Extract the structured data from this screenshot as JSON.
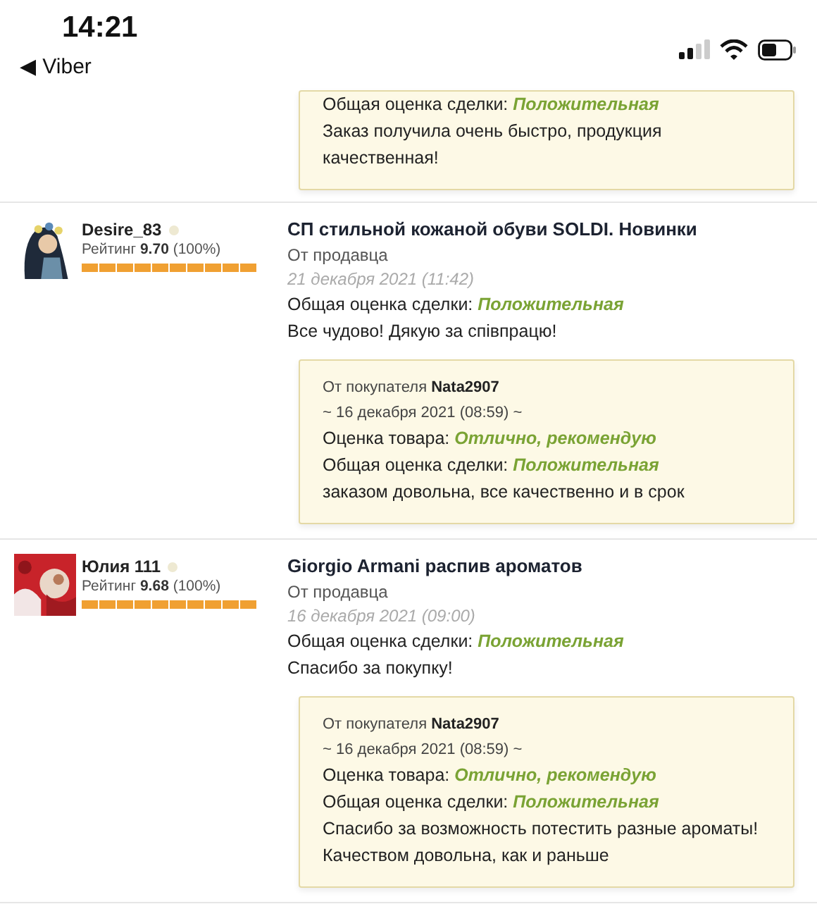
{
  "status_bar": {
    "time": "14:21",
    "back_label": "◀ Viber"
  },
  "partial_review": {
    "buyer_box": {
      "lines": [
        {
          "label": "Общая оценка сделки:",
          "value": "Положительная"
        }
      ],
      "comment": "Заказ получила очень быстро, продукция качественная!"
    }
  },
  "reviews": [
    {
      "user": {
        "name": "Desire_83",
        "online": false,
        "rating_label": "Рейтинг",
        "rating": "9.70",
        "percent": "(100%)"
      },
      "title": "СП стильной кожаной обуви SOLDI. Новинки",
      "source": "От продавца",
      "date": "21 декабря 2021 (11:42)",
      "overall_label": "Общая оценка сделки:",
      "overall_value": "Положительная",
      "comment": "Все чудово! Дякую за співпрацю!",
      "buyer_box": {
        "from_label": "От покупателя",
        "buyer": "Nata2907",
        "date": "~ 16 декабря 2021 (08:59) ~",
        "lines": [
          {
            "label": "Оценка товара:",
            "value": "Отлично, рекомендую"
          },
          {
            "label": "Общая оценка сделки:",
            "value": "Положительная"
          }
        ],
        "comment": "заказом довольна, все качественно и в срок"
      }
    },
    {
      "user": {
        "name": "Юлия 111",
        "online": false,
        "rating_label": "Рейтинг",
        "rating": "9.68",
        "percent": "(100%)"
      },
      "title": "Giorgio Armani распив ароматов",
      "source": "От продавца",
      "date": "16 декабря 2021 (09:00)",
      "overall_label": "Общая оценка сделки:",
      "overall_value": "Положительная",
      "comment": "Спасибо за покупку!",
      "buyer_box": {
        "from_label": "От покупателя",
        "buyer": "Nata2907",
        "date": "~ 16 декабря 2021 (08:59) ~",
        "lines": [
          {
            "label": "Оценка товара:",
            "value": "Отлично, рекомендую"
          },
          {
            "label": "Общая оценка сделки:",
            "value": "Положительная"
          }
        ],
        "comment": "Спасибо за возможность потестить разные ароматы! Качеством довольна, как и раньше"
      }
    }
  ]
}
